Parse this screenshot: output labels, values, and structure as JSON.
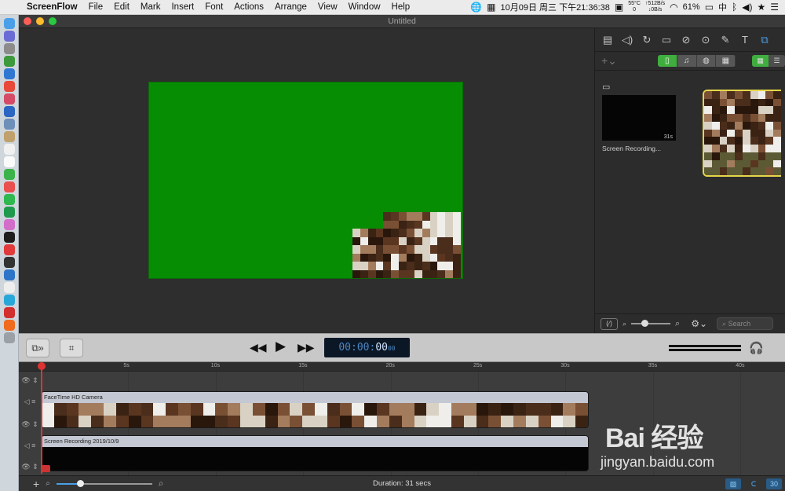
{
  "menubar": {
    "app_name": "ScreenFlow",
    "items": [
      "File",
      "Edit",
      "Mark",
      "Insert",
      "Font",
      "Actions",
      "Arrange",
      "View",
      "Window",
      "Help"
    ],
    "temp_top": "55°C",
    "temp_bottom": "0",
    "net_up": "↑512B/s",
    "net_down": "↓0B/s",
    "datetime": "10月09日 周三 下午21:36:38",
    "battery": "61%",
    "input_method": "中"
  },
  "window": {
    "title": "Untitled"
  },
  "media": {
    "item1_label": "Screen Recording...",
    "item1_duration": "31s"
  },
  "panel": {
    "search_placeholder": "Search"
  },
  "transport": {
    "timecode_main": "00:00:",
    "timecode_frames": "00",
    "timecode_sub": "00"
  },
  "timeline": {
    "ticks": [
      "5s",
      "10s",
      "15s",
      "20s",
      "25s",
      "30s",
      "35s",
      "40s"
    ],
    "track1_title": "FaceTime HD Camera",
    "track2_title": "Screen Recording 2019/10/9"
  },
  "bottombar": {
    "duration": "Duration: 31 secs",
    "btn3": "30"
  },
  "watermark": {
    "text": "Bai 经验",
    "url": "jingyan.baidu.com"
  },
  "colors": {
    "canvas_green": "#078d03",
    "accent_blue": "#4a9fe8",
    "playhead_red": "#dd3333",
    "selection_yellow": "#e6d64a"
  }
}
